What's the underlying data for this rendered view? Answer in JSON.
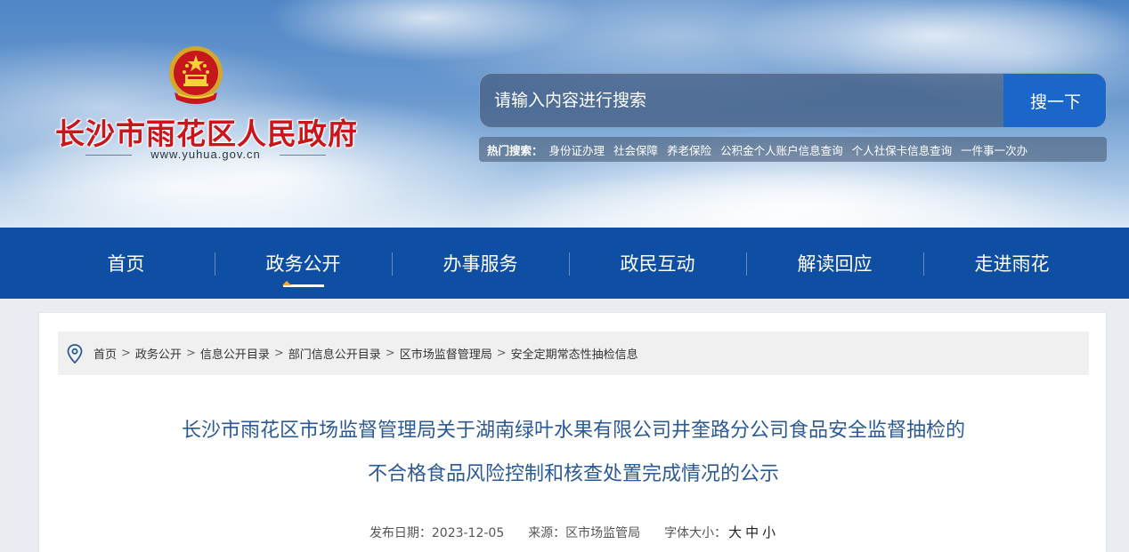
{
  "header": {
    "site_title": "长沙市雨花区人民政府",
    "site_url": "www.yuhua.gov.cn",
    "search": {
      "placeholder": "请输入内容进行搜索",
      "button_label": "搜一下"
    },
    "hot_search": {
      "label": "热门搜索：",
      "links": [
        "身份证办理",
        "社会保障",
        "养老保险",
        "公积金个人账户信息查询",
        "个人社保卡信息查询",
        "一件事一次办"
      ]
    },
    "colors": {
      "title_red": "#c8161d",
      "search_button": "#1a67c9"
    }
  },
  "nav": {
    "items": [
      {
        "label": "首页"
      },
      {
        "label": "政务公开",
        "active": true
      },
      {
        "label": "办事服务"
      },
      {
        "label": "政民互动"
      },
      {
        "label": "解读回应"
      },
      {
        "label": "走进雨花"
      }
    ],
    "background": "#0f4fa3"
  },
  "breadcrumb": {
    "icon": "location-pin-icon",
    "items": [
      "首页",
      "政务公开",
      "信息公开目录",
      "部门信息公开目录",
      "区市场监督管理局",
      "安全定期常态性抽检信息"
    ],
    "separator": ">"
  },
  "article": {
    "title_line1": "长沙市雨花区市场监督管理局关于湖南绿叶水果有限公司井奎路分公司食品安全监督抽检的",
    "title_line2": "不合格食品风险控制和核查处置完成情况的公示",
    "meta": {
      "date_label": "发布日期：",
      "date": "2023-12-05",
      "source_label": "来源：",
      "source": "区市场监管局",
      "font_size_label": "字体大小：",
      "font_sizes": [
        "大",
        "中",
        "小"
      ]
    }
  }
}
